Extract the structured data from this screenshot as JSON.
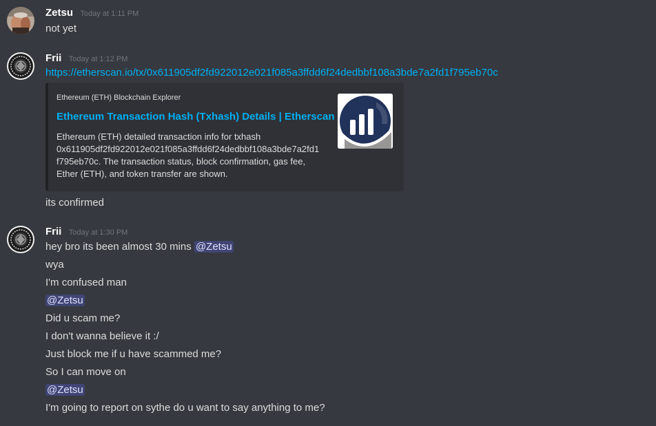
{
  "messages": [
    {
      "username": "Zetsu",
      "timestamp": "Today at 1:11 PM",
      "lines": [
        "not yet"
      ]
    },
    {
      "username": "Frii",
      "timestamp": "Today at 1:12 PM",
      "link": "https://etherscan.io/tx/0x611905df2fd922012e021f085a3ffdd6f24dedbbf108a3bde7a2fd1f795eb70c",
      "embed": {
        "provider": "Ethereum (ETH) Blockchain Explorer",
        "title": "Ethereum Transaction Hash (Txhash) Details | Etherscan",
        "description_lines": [
          "Ethereum (ETH) detailed transaction info for txhash",
          "0x611905df2fd922012e021f085a3ffdd6f24dedbbf108a3bde7a2fd1",
          "f795eb70c. The transaction status, block confirmation, gas fee,",
          "Ether (ETH), and token transfer are shown."
        ],
        "thumbnail_icon": "etherscan-logo-icon"
      },
      "followup": "its confirmed"
    },
    {
      "username": "Frii",
      "timestamp": "Today at 1:30 PM",
      "line1_text": "hey bro its been almost 30 mins ",
      "mention": "@Zetsu",
      "lines": [
        "wya",
        "I'm confused man",
        "@Zetsu",
        "Did u scam me?",
        "I don't wanna believe it :/",
        "Just block me if u have scammed me?",
        "So I can move on",
        "@Zetsu",
        "I'm going to report on sythe do u want to say anything to me?"
      ]
    }
  ],
  "colors": {
    "background": "#36393f",
    "embed_bg": "#2f3136",
    "link": "#00b0f4",
    "mention_bg": "#414675",
    "username": "#ffffff",
    "timestamp": "#72767d"
  }
}
